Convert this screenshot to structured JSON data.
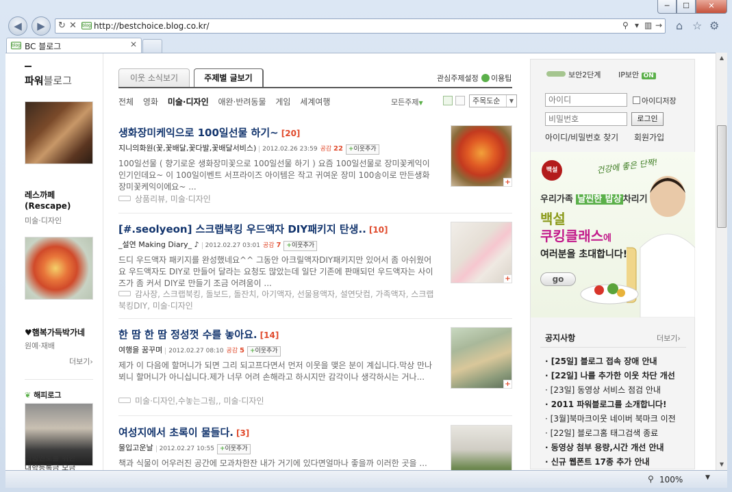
{
  "window": {
    "min_label": "─",
    "max_label": "☐",
    "close_label": "✕"
  },
  "browser": {
    "url": "http://bestchoice.blog.co.kr/",
    "tab_title": "BC 블로그",
    "favicon_text": "blog",
    "zoom": "100%"
  },
  "left": {
    "brand_bold": "파워",
    "brand_rest": "블로그",
    "items": [
      {
        "name": "레스까페\n(Rescape)",
        "category": "미술·디자인"
      },
      {
        "name": "♥햄복가득박가네",
        "category": "원예·재배"
      }
    ],
    "more": "더보기›",
    "happy_label": "해피로그",
    "happy_item": "러빙멘토를 위한\n대학등록금 모금"
  },
  "center": {
    "tabs": [
      "이웃 소식보기",
      "주제별 글보기"
    ],
    "interest": "관심주제설정",
    "user": "이용팁",
    "categories": [
      "전체",
      "영화",
      "미술·디자인",
      "애완·반려동물",
      "게임",
      "세계여행"
    ],
    "all_topics": "모든주제",
    "sort": "주목도순",
    "posts": [
      {
        "title": "생화장미케익으로 100일선물 하기~",
        "count": "[20]",
        "author": "지니의화원(꽃,꽃배달,꽃다발,꽃배달서비스)",
        "date": "2012.02.26 23:59",
        "sympathy_label": "공감",
        "sympathy": "22",
        "add": "이웃추가",
        "body": "100일선물 ( 향기로운 생화장미꽃으로 100일선물 하기 ) 요즘 100일선물로 장미꽃케익이 인기인데요~ 이 100일이벤트 서프라이즈 아이템은 작고 귀여운 장미 100송이로 만든생화 장미꽃케익이에요~ ...",
        "tags": "상품리뷰, 미술·디자인"
      },
      {
        "title": "[#.seolyeon] 스크랩북킹 우드액자 DIY패키지 탄생..",
        "count": "[10]",
        "author": "_설연 Making Diary_ ♪",
        "date": "2012.02.27 03:01",
        "sympathy_label": "공감",
        "sympathy": "7",
        "add": "이웃추가",
        "body": "드디 우드액자 패키지를 완성했네요^^ 그동안 아크릴액자DIY패키지만 있어서 좀 아쉬웠어요 우드액자도 DIY로 만들어 달라는 요청도 많았는데 일단 기존에 판매되던 우드액자는 사이즈가 좀 커서 DIY로 만들기 조금 어려움이 ...",
        "tags": "감사장, 스크랩북킹, 돌보드, 돌잔치, 아기액자, 선물용액자, 설연닷컴, 가족액자, 스크랩북킹DIY, 미술·디자인"
      },
      {
        "title": "한 땀 한 땀 정성껏 수를 놓아요.",
        "count": "[14]",
        "author": "여행을 꿈꾸며",
        "date": "2012.02.27 08:10",
        "sympathy_label": "공감",
        "sympathy": "5",
        "add": "이웃추가",
        "body": "제가 이 다음에 할머니가 되면 그리 되고프다면서 먼저 이웃을 맺은 분이 계십니다.막상 만나뵈니 할머니가 아니십니다.제가 너무 어려 손해라고 하시지만 감각이나 생각하시는 거나...",
        "tags": "미술·디자인,수놓는그림,, 미술·디자인"
      },
      {
        "title": "여성지에서 초록이 물들다.",
        "count": "[3]",
        "author": "물입고운날",
        "date": "2012.02.27 10:55",
        "sympathy_label": "",
        "sympathy": "",
        "add": "이웃추가",
        "body": "책과 식물이 어우러진 공간에 모과차한잔 내가 거기에 있다면얼마나 좋을까 이러한 곳을 ...",
        "tags": ""
      }
    ]
  },
  "right": {
    "security": "보안2단계",
    "ipsec": "IP보안",
    "ipsec_state": "ON",
    "id_placeholder": "아이디",
    "pw_placeholder": "비밀번호",
    "save_id": "아이디저장",
    "login": "로그인",
    "find": "아이디/비밀번호 찾기",
    "join": "회원가입",
    "ad": {
      "logo": "백설",
      "tagline": "건강에 좋은 단짝!",
      "line1_pre": "우리가족 ",
      "line1_hl": "날씬한 밥상",
      "line1_post": "차리기",
      "line2": "백설",
      "line3": "쿠킹클래스",
      "line3_small": "에",
      "line4": "여러분을 초대합니다!",
      "go": "go"
    },
    "notice_title": "공지사항",
    "notice_more": "더보기›",
    "notices": [
      {
        "text": "[25일] 블로그 접속 장애 안내",
        "bold": true
      },
      {
        "text": "[22일] 나를 추가한 이웃 차단 개선",
        "bold": true
      },
      {
        "text": "[23일] 동영상 서비스 점검 안내",
        "bold": false
      },
      {
        "text": "2011 파워블로그를 소개합니다!",
        "bold": true
      },
      {
        "text": "[3월]북마크이웃 네이버 북마크 이전",
        "bold": false
      },
      {
        "text": "[22일] 블로그홈 태그검색 종료",
        "bold": false
      },
      {
        "text": "동영상 첨부 용량,시간 개선 안내",
        "bold": true
      },
      {
        "text": "신규 웹폰트 17종 추가 안내",
        "bold": true
      }
    ]
  }
}
